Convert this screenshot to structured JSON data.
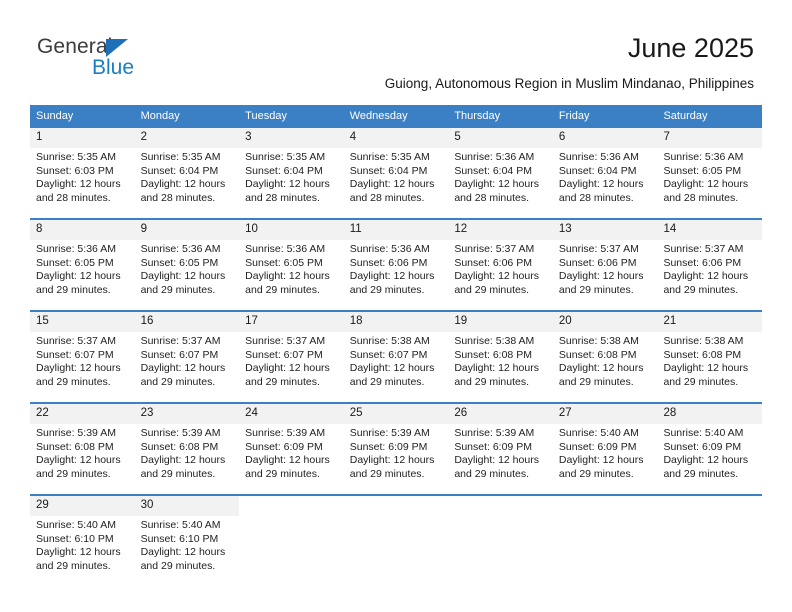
{
  "brand": {
    "name_top": "General",
    "name_bottom": "Blue",
    "color_dark": "#3c3c3c",
    "color_blue": "#1b7ec4"
  },
  "header": {
    "month_title": "June 2025",
    "subtitle": "Guiong, Autonomous Region in Muslim Mindanao, Philippines"
  },
  "theme": {
    "header_blue": "#3b7fc4",
    "daynum_band": "#f2f2f2",
    "text": "#1a1a1a"
  },
  "calendar": {
    "day_names": [
      "Sunday",
      "Monday",
      "Tuesday",
      "Wednesday",
      "Thursday",
      "Friday",
      "Saturday"
    ],
    "weeks": [
      [
        {
          "day": "1",
          "sunrise": "Sunrise: 5:35 AM",
          "sunset": "Sunset: 6:03 PM",
          "daylight_line1": "Daylight: 12 hours",
          "daylight_line2": "and 28 minutes."
        },
        {
          "day": "2",
          "sunrise": "Sunrise: 5:35 AM",
          "sunset": "Sunset: 6:04 PM",
          "daylight_line1": "Daylight: 12 hours",
          "daylight_line2": "and 28 minutes."
        },
        {
          "day": "3",
          "sunrise": "Sunrise: 5:35 AM",
          "sunset": "Sunset: 6:04 PM",
          "daylight_line1": "Daylight: 12 hours",
          "daylight_line2": "and 28 minutes."
        },
        {
          "day": "4",
          "sunrise": "Sunrise: 5:35 AM",
          "sunset": "Sunset: 6:04 PM",
          "daylight_line1": "Daylight: 12 hours",
          "daylight_line2": "and 28 minutes."
        },
        {
          "day": "5",
          "sunrise": "Sunrise: 5:36 AM",
          "sunset": "Sunset: 6:04 PM",
          "daylight_line1": "Daylight: 12 hours",
          "daylight_line2": "and 28 minutes."
        },
        {
          "day": "6",
          "sunrise": "Sunrise: 5:36 AM",
          "sunset": "Sunset: 6:04 PM",
          "daylight_line1": "Daylight: 12 hours",
          "daylight_line2": "and 28 minutes."
        },
        {
          "day": "7",
          "sunrise": "Sunrise: 5:36 AM",
          "sunset": "Sunset: 6:05 PM",
          "daylight_line1": "Daylight: 12 hours",
          "daylight_line2": "and 28 minutes."
        }
      ],
      [
        {
          "day": "8",
          "sunrise": "Sunrise: 5:36 AM",
          "sunset": "Sunset: 6:05 PM",
          "daylight_line1": "Daylight: 12 hours",
          "daylight_line2": "and 29 minutes."
        },
        {
          "day": "9",
          "sunrise": "Sunrise: 5:36 AM",
          "sunset": "Sunset: 6:05 PM",
          "daylight_line1": "Daylight: 12 hours",
          "daylight_line2": "and 29 minutes."
        },
        {
          "day": "10",
          "sunrise": "Sunrise: 5:36 AM",
          "sunset": "Sunset: 6:05 PM",
          "daylight_line1": "Daylight: 12 hours",
          "daylight_line2": "and 29 minutes."
        },
        {
          "day": "11",
          "sunrise": "Sunrise: 5:36 AM",
          "sunset": "Sunset: 6:06 PM",
          "daylight_line1": "Daylight: 12 hours",
          "daylight_line2": "and 29 minutes."
        },
        {
          "day": "12",
          "sunrise": "Sunrise: 5:37 AM",
          "sunset": "Sunset: 6:06 PM",
          "daylight_line1": "Daylight: 12 hours",
          "daylight_line2": "and 29 minutes."
        },
        {
          "day": "13",
          "sunrise": "Sunrise: 5:37 AM",
          "sunset": "Sunset: 6:06 PM",
          "daylight_line1": "Daylight: 12 hours",
          "daylight_line2": "and 29 minutes."
        },
        {
          "day": "14",
          "sunrise": "Sunrise: 5:37 AM",
          "sunset": "Sunset: 6:06 PM",
          "daylight_line1": "Daylight: 12 hours",
          "daylight_line2": "and 29 minutes."
        }
      ],
      [
        {
          "day": "15",
          "sunrise": "Sunrise: 5:37 AM",
          "sunset": "Sunset: 6:07 PM",
          "daylight_line1": "Daylight: 12 hours",
          "daylight_line2": "and 29 minutes."
        },
        {
          "day": "16",
          "sunrise": "Sunrise: 5:37 AM",
          "sunset": "Sunset: 6:07 PM",
          "daylight_line1": "Daylight: 12 hours",
          "daylight_line2": "and 29 minutes."
        },
        {
          "day": "17",
          "sunrise": "Sunrise: 5:37 AM",
          "sunset": "Sunset: 6:07 PM",
          "daylight_line1": "Daylight: 12 hours",
          "daylight_line2": "and 29 minutes."
        },
        {
          "day": "18",
          "sunrise": "Sunrise: 5:38 AM",
          "sunset": "Sunset: 6:07 PM",
          "daylight_line1": "Daylight: 12 hours",
          "daylight_line2": "and 29 minutes."
        },
        {
          "day": "19",
          "sunrise": "Sunrise: 5:38 AM",
          "sunset": "Sunset: 6:08 PM",
          "daylight_line1": "Daylight: 12 hours",
          "daylight_line2": "and 29 minutes."
        },
        {
          "day": "20",
          "sunrise": "Sunrise: 5:38 AM",
          "sunset": "Sunset: 6:08 PM",
          "daylight_line1": "Daylight: 12 hours",
          "daylight_line2": "and 29 minutes."
        },
        {
          "day": "21",
          "sunrise": "Sunrise: 5:38 AM",
          "sunset": "Sunset: 6:08 PM",
          "daylight_line1": "Daylight: 12 hours",
          "daylight_line2": "and 29 minutes."
        }
      ],
      [
        {
          "day": "22",
          "sunrise": "Sunrise: 5:39 AM",
          "sunset": "Sunset: 6:08 PM",
          "daylight_line1": "Daylight: 12 hours",
          "daylight_line2": "and 29 minutes."
        },
        {
          "day": "23",
          "sunrise": "Sunrise: 5:39 AM",
          "sunset": "Sunset: 6:08 PM",
          "daylight_line1": "Daylight: 12 hours",
          "daylight_line2": "and 29 minutes."
        },
        {
          "day": "24",
          "sunrise": "Sunrise: 5:39 AM",
          "sunset": "Sunset: 6:09 PM",
          "daylight_line1": "Daylight: 12 hours",
          "daylight_line2": "and 29 minutes."
        },
        {
          "day": "25",
          "sunrise": "Sunrise: 5:39 AM",
          "sunset": "Sunset: 6:09 PM",
          "daylight_line1": "Daylight: 12 hours",
          "daylight_line2": "and 29 minutes."
        },
        {
          "day": "26",
          "sunrise": "Sunrise: 5:39 AM",
          "sunset": "Sunset: 6:09 PM",
          "daylight_line1": "Daylight: 12 hours",
          "daylight_line2": "and 29 minutes."
        },
        {
          "day": "27",
          "sunrise": "Sunrise: 5:40 AM",
          "sunset": "Sunset: 6:09 PM",
          "daylight_line1": "Daylight: 12 hours",
          "daylight_line2": "and 29 minutes."
        },
        {
          "day": "28",
          "sunrise": "Sunrise: 5:40 AM",
          "sunset": "Sunset: 6:09 PM",
          "daylight_line1": "Daylight: 12 hours",
          "daylight_line2": "and 29 minutes."
        }
      ],
      [
        {
          "day": "29",
          "sunrise": "Sunrise: 5:40 AM",
          "sunset": "Sunset: 6:10 PM",
          "daylight_line1": "Daylight: 12 hours",
          "daylight_line2": "and 29 minutes."
        },
        {
          "day": "30",
          "sunrise": "Sunrise: 5:40 AM",
          "sunset": "Sunset: 6:10 PM",
          "daylight_line1": "Daylight: 12 hours",
          "daylight_line2": "and 29 minutes."
        },
        {
          "day": "",
          "sunrise": "",
          "sunset": "",
          "daylight_line1": "",
          "daylight_line2": ""
        },
        {
          "day": "",
          "sunrise": "",
          "sunset": "",
          "daylight_line1": "",
          "daylight_line2": ""
        },
        {
          "day": "",
          "sunrise": "",
          "sunset": "",
          "daylight_line1": "",
          "daylight_line2": ""
        },
        {
          "day": "",
          "sunrise": "",
          "sunset": "",
          "daylight_line1": "",
          "daylight_line2": ""
        },
        {
          "day": "",
          "sunrise": "",
          "sunset": "",
          "daylight_line1": "",
          "daylight_line2": ""
        }
      ]
    ]
  }
}
